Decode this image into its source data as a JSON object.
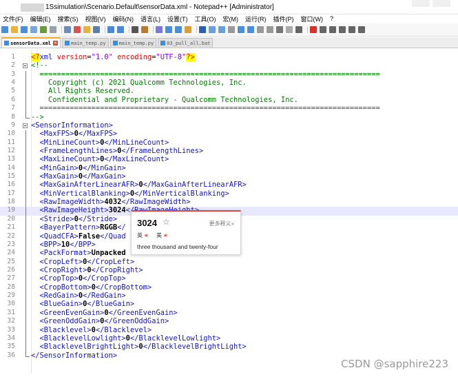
{
  "window": {
    "title": "1Ssimulation\\Scenario.Default\\sensorData.xml - Notepad++ [Administrator]"
  },
  "menu": [
    "文件(F)",
    "编辑(E)",
    "搜索(S)",
    "视图(V)",
    "编码(N)",
    "语言(L)",
    "设置(T)",
    "工具(O)",
    "宏(M)",
    "运行(R)",
    "插件(P)",
    "窗口(W)",
    "?"
  ],
  "tabs": [
    {
      "label": "sensorData.xml",
      "active": true
    },
    {
      "label": "main_temp.py",
      "active": false
    },
    {
      "label": "main_temp.py",
      "active": false
    },
    {
      "label": "03_pull_all.bat",
      "active": false
    }
  ],
  "editor": {
    "current_line": 19,
    "lines": [
      {
        "n": "1",
        "code": "<?xml version=\"1.0\" encoding=\"UTF-8\"?>"
      },
      {
        "n": "2",
        "code": "<!--"
      },
      {
        "n": "3",
        "code": "  ==============================================================================="
      },
      {
        "n": "4",
        "code": "    Copyright (c) 2021 Qualcomm Technologies, Inc."
      },
      {
        "n": "5",
        "code": "    All Rights Reserved."
      },
      {
        "n": "6",
        "code": "    Confidential and Proprietary - Qualcomm Technologies, Inc."
      },
      {
        "n": "7",
        "code": "  ==============================================================================="
      },
      {
        "n": "8",
        "code": "-->"
      },
      {
        "n": "9",
        "code": "<SensorInformation>"
      },
      {
        "n": "10",
        "code": "  <MaxFPS>0</MaxFPS>"
      },
      {
        "n": "11",
        "code": "  <MinLineCount>0</MinLineCount>"
      },
      {
        "n": "12",
        "code": "  <FrameLengthLines>0</FrameLengthLines>"
      },
      {
        "n": "13",
        "code": "  <MaxLineCount>0</MaxLineCount>"
      },
      {
        "n": "14",
        "code": "  <MinGain>0</MinGain>"
      },
      {
        "n": "15",
        "code": "  <MaxGain>0</MaxGain>"
      },
      {
        "n": "16",
        "code": "  <MaxGainAfterLinearAFR>0</MaxGainAfterLinearAFR>"
      },
      {
        "n": "17",
        "code": "  <MinVerticalBlanking>0</MinVerticalBlanking>"
      },
      {
        "n": "18",
        "code": "  <RawImageWidth>4032</RawImageWidth>"
      },
      {
        "n": "19",
        "code": "  <RawImageHeight>3024</RawImageHeight>"
      },
      {
        "n": "20",
        "code": "  <Stride>0</Stride>"
      },
      {
        "n": "21",
        "code": "  <BayerPattern>RGGB</"
      },
      {
        "n": "22",
        "code": "  <QuadCFA>False</Quad"
      },
      {
        "n": "23",
        "code": "  <BPP>10</BPP>"
      },
      {
        "n": "24",
        "code": "  <PackFormat>Unpacked"
      },
      {
        "n": "25",
        "code": "  <CropLeft>0</CropLeft>"
      },
      {
        "n": "26",
        "code": "  <CropRight>0</CropRight>"
      },
      {
        "n": "27",
        "code": "  <CropTop>0</CropTop>"
      },
      {
        "n": "28",
        "code": "  <CropBottom>0</CropBottom>"
      },
      {
        "n": "29",
        "code": "  <RedGain>0</RedGain>"
      },
      {
        "n": "30",
        "code": "  <BlueGain>0</BlueGain>"
      },
      {
        "n": "31",
        "code": "  <GreenEvenGain>0</GreenEvenGain>"
      },
      {
        "n": "32",
        "code": "  <GreenOddGain>0</GreenOddGain>"
      },
      {
        "n": "33",
        "code": "  <Blacklevel>0</Blacklevel>"
      },
      {
        "n": "34",
        "code": "  <BlacklevelLowlight>0</BlacklevelLowlight>"
      },
      {
        "n": "35",
        "code": "  <BlacklevelBrightLight>0</BlacklevelBrightLight>"
      },
      {
        "n": "36",
        "code": "</SensorInformation>"
      }
    ]
  },
  "translate_popup": {
    "word": "3024",
    "star_icon": "star-outline-icon",
    "more_label": "更多释义»",
    "uk_label": "英",
    "us_label": "美",
    "speaker_icon": "speaker-icon",
    "definition": "three thousand and twenty-four"
  },
  "watermark": "CSDN @sapphire223",
  "colors": {
    "tag": "#1414c8",
    "attribute": "#ff0000",
    "value": "#8000ff",
    "comment": "#008000",
    "current_line": "#e8e8ff",
    "popup_accent": "#e0463a"
  }
}
